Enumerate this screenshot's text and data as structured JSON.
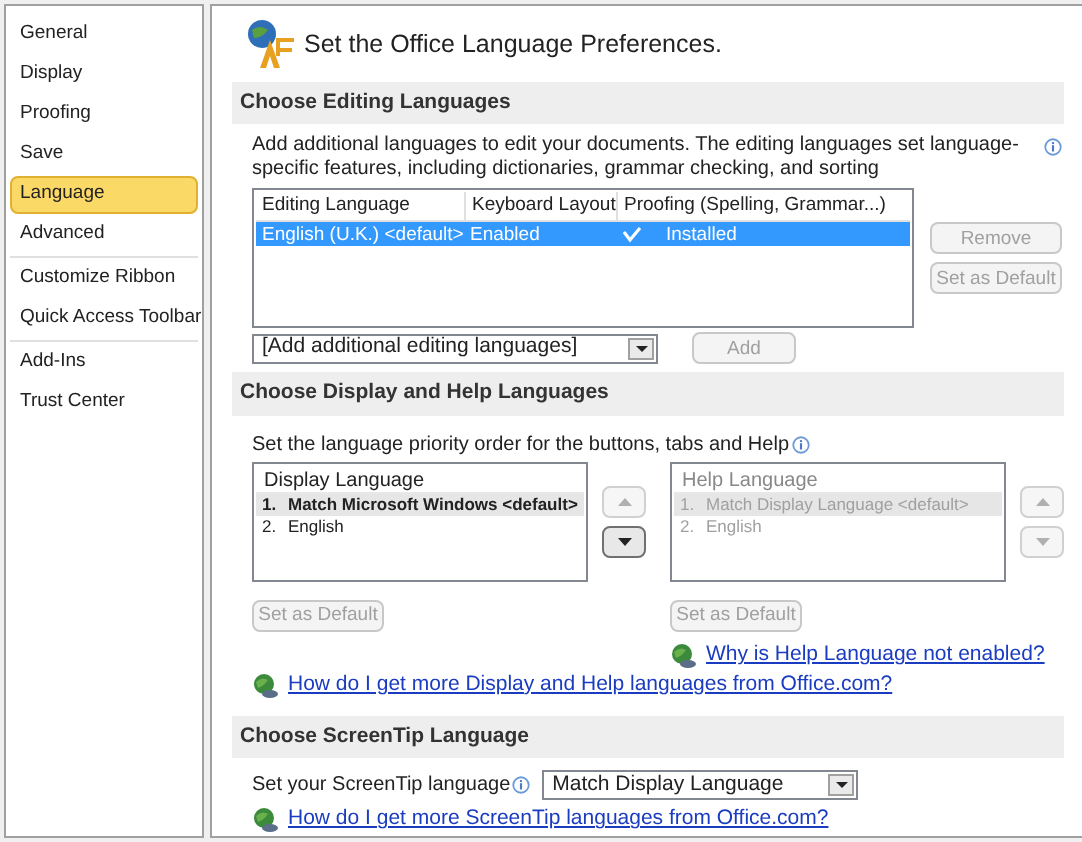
{
  "sidebar": {
    "groups": [
      {
        "items": [
          {
            "label": "General",
            "selected": false
          },
          {
            "label": "Display",
            "selected": false
          },
          {
            "label": "Proofing",
            "selected": false
          },
          {
            "label": "Save",
            "selected": false
          },
          {
            "label": "Language",
            "selected": true
          },
          {
            "label": "Advanced",
            "selected": false
          }
        ]
      },
      {
        "items": [
          {
            "label": "Customize Ribbon",
            "selected": false
          },
          {
            "label": "Quick Access Toolbar",
            "selected": false
          }
        ]
      },
      {
        "items": [
          {
            "label": "Add-Ins",
            "selected": false
          },
          {
            "label": "Trust Center",
            "selected": false
          }
        ]
      }
    ]
  },
  "header": {
    "title": "Set the Office Language Preferences."
  },
  "editing": {
    "heading": "Choose Editing Languages",
    "description": "Add additional languages to edit your documents. The editing languages set language-specific features, including dictionaries, grammar checking, and sorting",
    "table": {
      "columns": [
        "Editing Language",
        "Keyboard Layout",
        "Proofing (Spelling, Grammar...)"
      ],
      "rows": [
        {
          "cells": [
            "English (U.K.) <default>",
            "Enabled",
            "Installed"
          ],
          "selected": true
        }
      ]
    },
    "buttons": [
      {
        "label": "Remove",
        "disabled": true
      },
      {
        "label": "Set as Default",
        "disabled": true
      }
    ],
    "dropdown": {
      "value": "[Add additional editing languages]"
    },
    "add_button": {
      "label": "Add",
      "disabled": true
    }
  },
  "display_help": {
    "heading": "Choose Display and Help Languages",
    "description": "Set the language priority order for the buttons, tabs and Help",
    "lists": [
      {
        "title": "Display Language",
        "disabled": false,
        "items": [
          {
            "number": "1.",
            "label": "Match Microsoft Windows <default>",
            "selected": true
          },
          {
            "number": "2.",
            "label": "English",
            "selected": false
          }
        ],
        "up_disabled": true,
        "down_disabled": false,
        "set_default": {
          "label": "Set as Default",
          "disabled": true
        }
      },
      {
        "title": "Help Language",
        "disabled": true,
        "items": [
          {
            "number": "1.",
            "label": "Match Display Language <default>",
            "selected": true
          },
          {
            "number": "2.",
            "label": "English",
            "selected": false
          }
        ],
        "up_disabled": true,
        "down_disabled": true,
        "set_default": {
          "label": "Set as Default",
          "disabled": true
        },
        "link": "Why is Help Language not enabled?"
      }
    ],
    "link": "How do I get more Display and Help languages from Office.com?"
  },
  "screentip": {
    "heading": "Choose ScreenTip Language",
    "label": "Set your ScreenTip language",
    "dropdown": {
      "value": "Match Display Language"
    },
    "link": "How do I get more ScreenTip languages from Office.com?"
  }
}
